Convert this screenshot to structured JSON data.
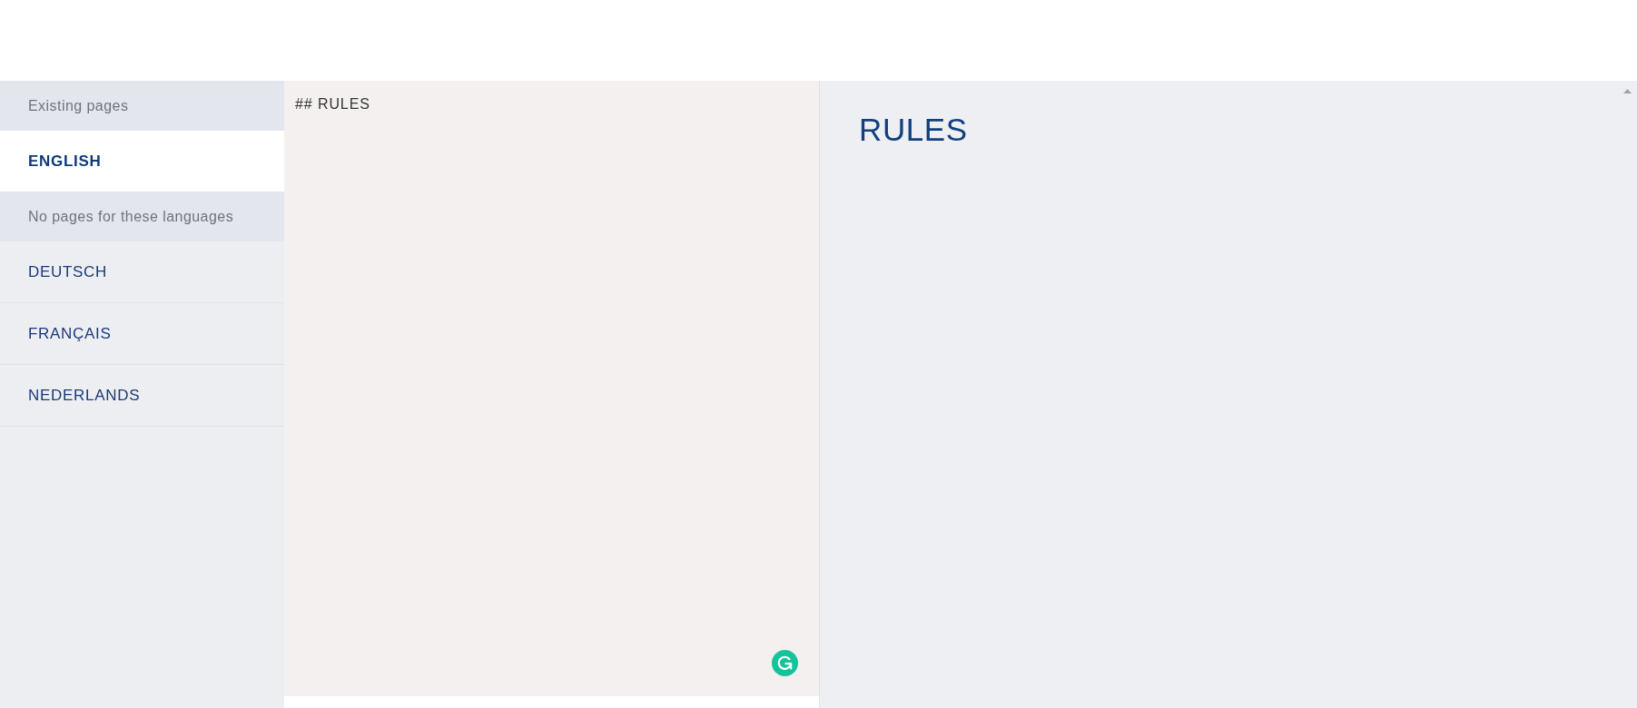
{
  "sidebar": {
    "sections": [
      {
        "heading": "Existing pages",
        "items": [
          {
            "label": "ENGLISH",
            "selected": true
          }
        ]
      },
      {
        "heading": "No pages for these languages",
        "items": [
          {
            "label": "DEUTSCH",
            "selected": false
          },
          {
            "label": "FRANÇAIS",
            "selected": false
          },
          {
            "label": "NEDERLANDS",
            "selected": false
          }
        ]
      }
    ]
  },
  "editor": {
    "value": "## RULES"
  },
  "preview": {
    "title": "RULES"
  }
}
